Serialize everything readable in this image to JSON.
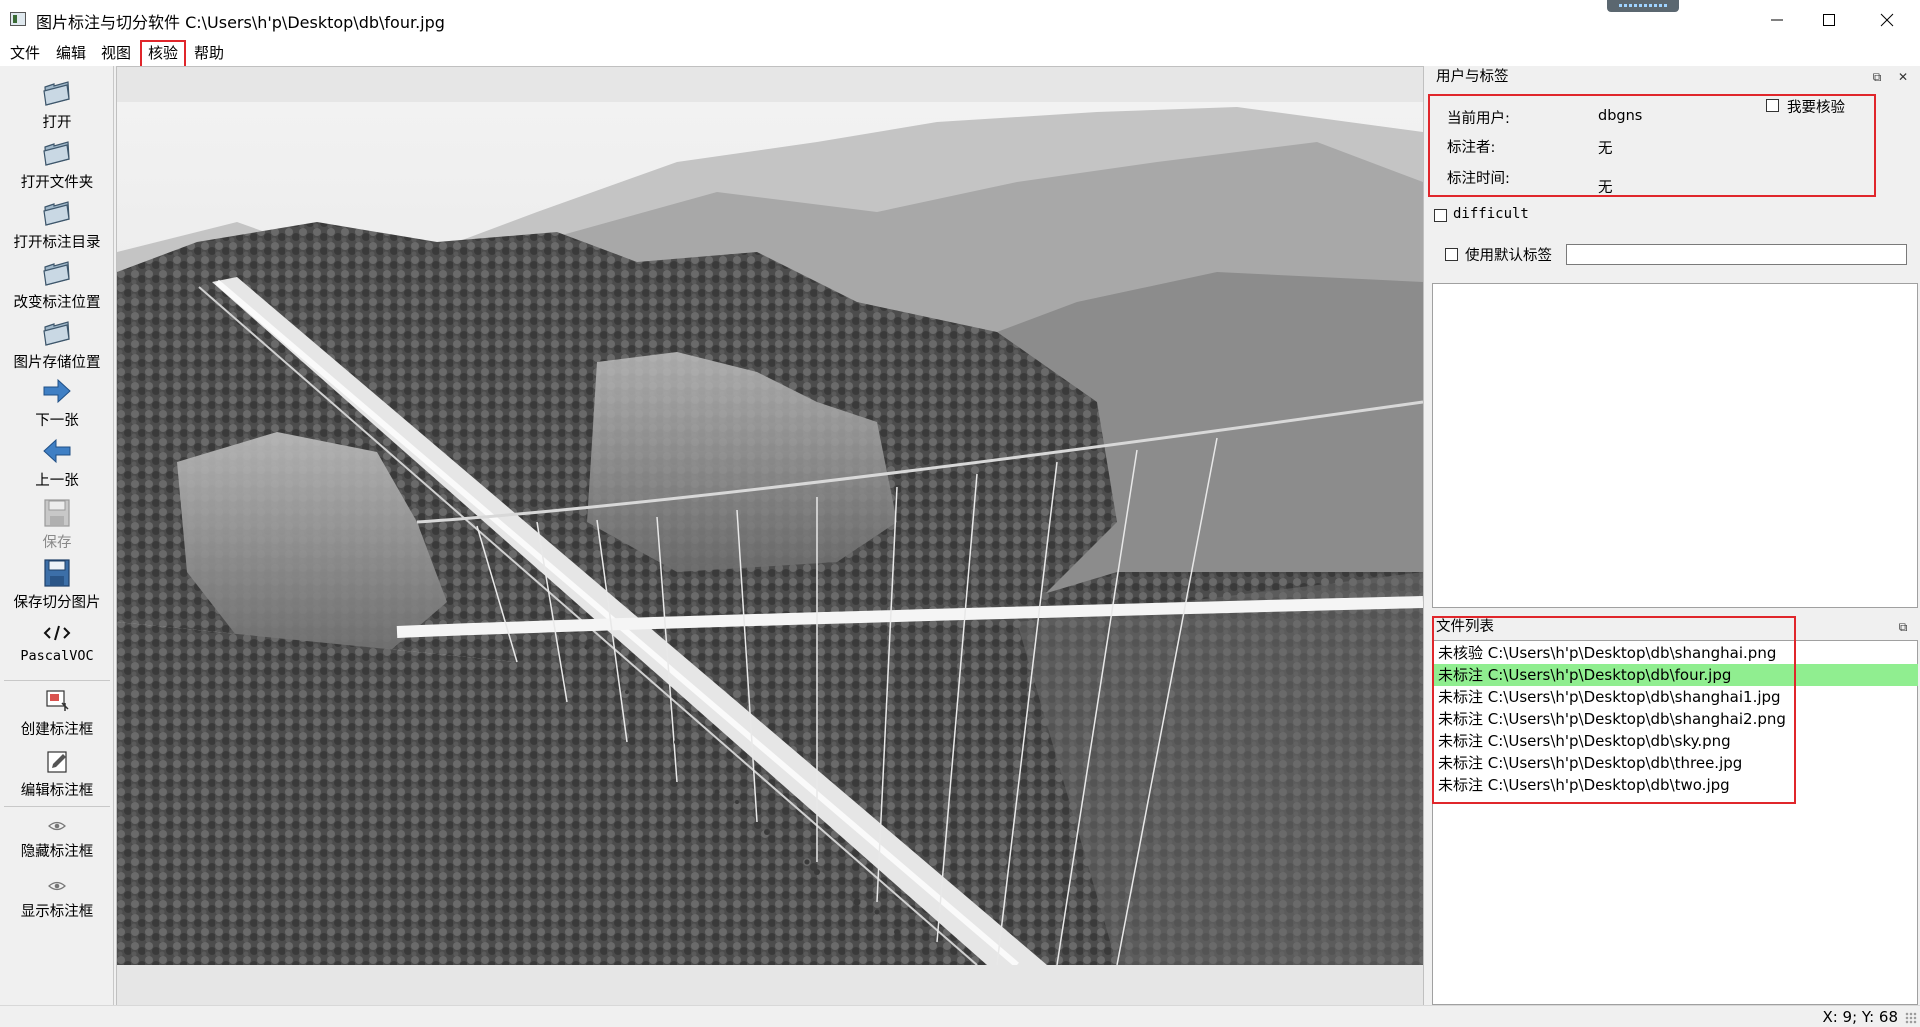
{
  "window": {
    "title": "图片标注与切分软件 C:\\Users\\h'p\\Desktop\\db\\four.jpg",
    "controls": [
      "minimize",
      "maximize",
      "close"
    ]
  },
  "menu": [
    "文件",
    "编辑",
    "视图",
    "核验",
    "帮助"
  ],
  "toolbar": [
    {
      "label": "打开",
      "icon": "folder-icon",
      "enabled": true
    },
    {
      "label": "打开文件夹",
      "icon": "folder-icon",
      "enabled": true
    },
    {
      "label": "打开标注目录",
      "icon": "folder-icon",
      "enabled": true
    },
    {
      "label": "改变标注位置",
      "icon": "folder-icon",
      "enabled": true
    },
    {
      "label": "图片存储位置",
      "icon": "folder-icon",
      "enabled": true
    },
    {
      "label": "下一张",
      "icon": "arrow-right-icon",
      "enabled": true
    },
    {
      "label": "上一张",
      "icon": "arrow-left-icon",
      "enabled": true
    },
    {
      "label": "保存",
      "icon": "save-icon",
      "enabled": false
    },
    {
      "label": "保存切分图片",
      "icon": "save-icon",
      "enabled": true
    },
    {
      "label": "PascalVOC",
      "icon": "code-icon",
      "enabled": true
    },
    {
      "label": "创建标注框",
      "icon": "create-box-icon",
      "enabled": true
    },
    {
      "label": "编辑标注框",
      "icon": "edit-box-icon",
      "enabled": true
    },
    {
      "label": "隐藏标注框",
      "icon": "eye-icon",
      "enabled": true
    },
    {
      "label": "显示标注框",
      "icon": "eye-icon",
      "enabled": true
    }
  ],
  "label_panel": {
    "title": "用户与标签",
    "current_user_label": "当前用户:",
    "current_user_value": "dbgns",
    "annotator_label": "标注者:",
    "annotator_value": "无",
    "annotate_time_label": "标注时间:",
    "annotate_time_value": "无",
    "verify_checkbox": "我要核验",
    "verify_checked": false,
    "difficult_checkbox": "difficult",
    "difficult_checked": false,
    "default_label_checkbox": "使用默认标签",
    "default_label_checked": false,
    "default_label_value": ""
  },
  "file_list": {
    "title": "文件列表",
    "items": [
      {
        "text": "未核验 C:\\Users\\h'p\\Desktop\\db\\shanghai.png",
        "selected": false
      },
      {
        "text": "未标注 C:\\Users\\h'p\\Desktop\\db\\four.jpg",
        "selected": true
      },
      {
        "text": "未标注 C:\\Users\\h'p\\Desktop\\db\\shanghai1.jpg",
        "selected": false
      },
      {
        "text": "未标注 C:\\Users\\h'p\\Desktop\\db\\shanghai2.png",
        "selected": false
      },
      {
        "text": "未标注 C:\\Users\\h'p\\Desktop\\db\\sky.png",
        "selected": false
      },
      {
        "text": "未标注 C:\\Users\\h'p\\Desktop\\db\\three.jpg",
        "selected": false
      },
      {
        "text": "未标注 C:\\Users\\h'p\\Desktop\\db\\two.jpg",
        "selected": false
      }
    ]
  },
  "status": {
    "cursor": "X: 9; Y: 68"
  },
  "colors": {
    "highlight_border": "#e0262b",
    "selected_row": "#90ee90"
  }
}
